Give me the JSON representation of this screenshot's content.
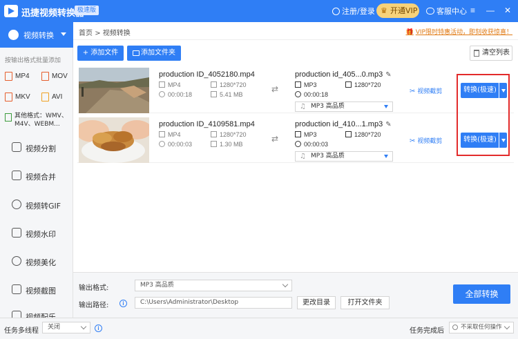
{
  "app": {
    "title": "迅捷视频转换器",
    "badge": "极速版",
    "login": "注册/登录",
    "vip": "开通VIP",
    "service": "客服中心"
  },
  "window": {
    "menu": "≡",
    "minimize": "—",
    "close": "✕"
  },
  "sidebar": {
    "active": "视频转换",
    "hint": "按输出格式批量添加",
    "formats": [
      "MP4",
      "MOV",
      "MKV",
      "AVI"
    ],
    "other": "其他格式：WMV、M4V、WEBM...",
    "items": [
      "视频分割",
      "视频合并",
      "视频转GIF",
      "视频水印",
      "视频美化",
      "视频截图",
      "视频配乐"
    ]
  },
  "breadcrumb": {
    "home": "首页",
    "sep": ">",
    "current": "视频转换"
  },
  "promo": "VIP限时特惠活动，即刻收获惊喜！",
  "toolbar": {
    "add_file": "+ 添加文件",
    "add_folder": "添加文件夹",
    "clear": "清空列表"
  },
  "files": [
    {
      "src_name": "production ID_4052180.mp4",
      "src_fmt": "MP4",
      "src_res": "1280*720",
      "src_dur": "00:00:18",
      "src_size": "5.41 MB",
      "out_name": "production id_405...0.mp3",
      "out_fmt": "MP3",
      "out_res": "1280*720",
      "out_dur": "00:00:18",
      "out_select": "MP3   高品质",
      "cut": "视频截剪",
      "convert": "转换(极速)"
    },
    {
      "src_name": "production ID_4109581.mp4",
      "src_fmt": "MP4",
      "src_res": "1280*720",
      "src_dur": "00:00:03",
      "src_size": "1.30 MB",
      "out_name": "production id_410...1.mp3",
      "out_fmt": "MP3",
      "out_res": "1280*720",
      "out_dur": "00:00:03",
      "out_select": "MP3   高品质",
      "cut": "视频截剪",
      "convert": "转换(极速)"
    }
  ],
  "bottom": {
    "format_label": "输出格式:",
    "format_value": "MP3   高品质",
    "path_label": "输出路径:",
    "path_value": "C:\\Users\\Administrator\\Desktop",
    "change_dir": "更改目录",
    "open_folder": "打开文件夹",
    "convert_all": "全部转换"
  },
  "status": {
    "multithread_label": "任务多线程",
    "multithread_value": "关闭",
    "after_label": "任务完成后",
    "after_value": "不采取任何操作"
  },
  "colors": {
    "primary": "#2f7ef5",
    "highlight": "#e32a2a",
    "vip": "#f7d27a"
  }
}
